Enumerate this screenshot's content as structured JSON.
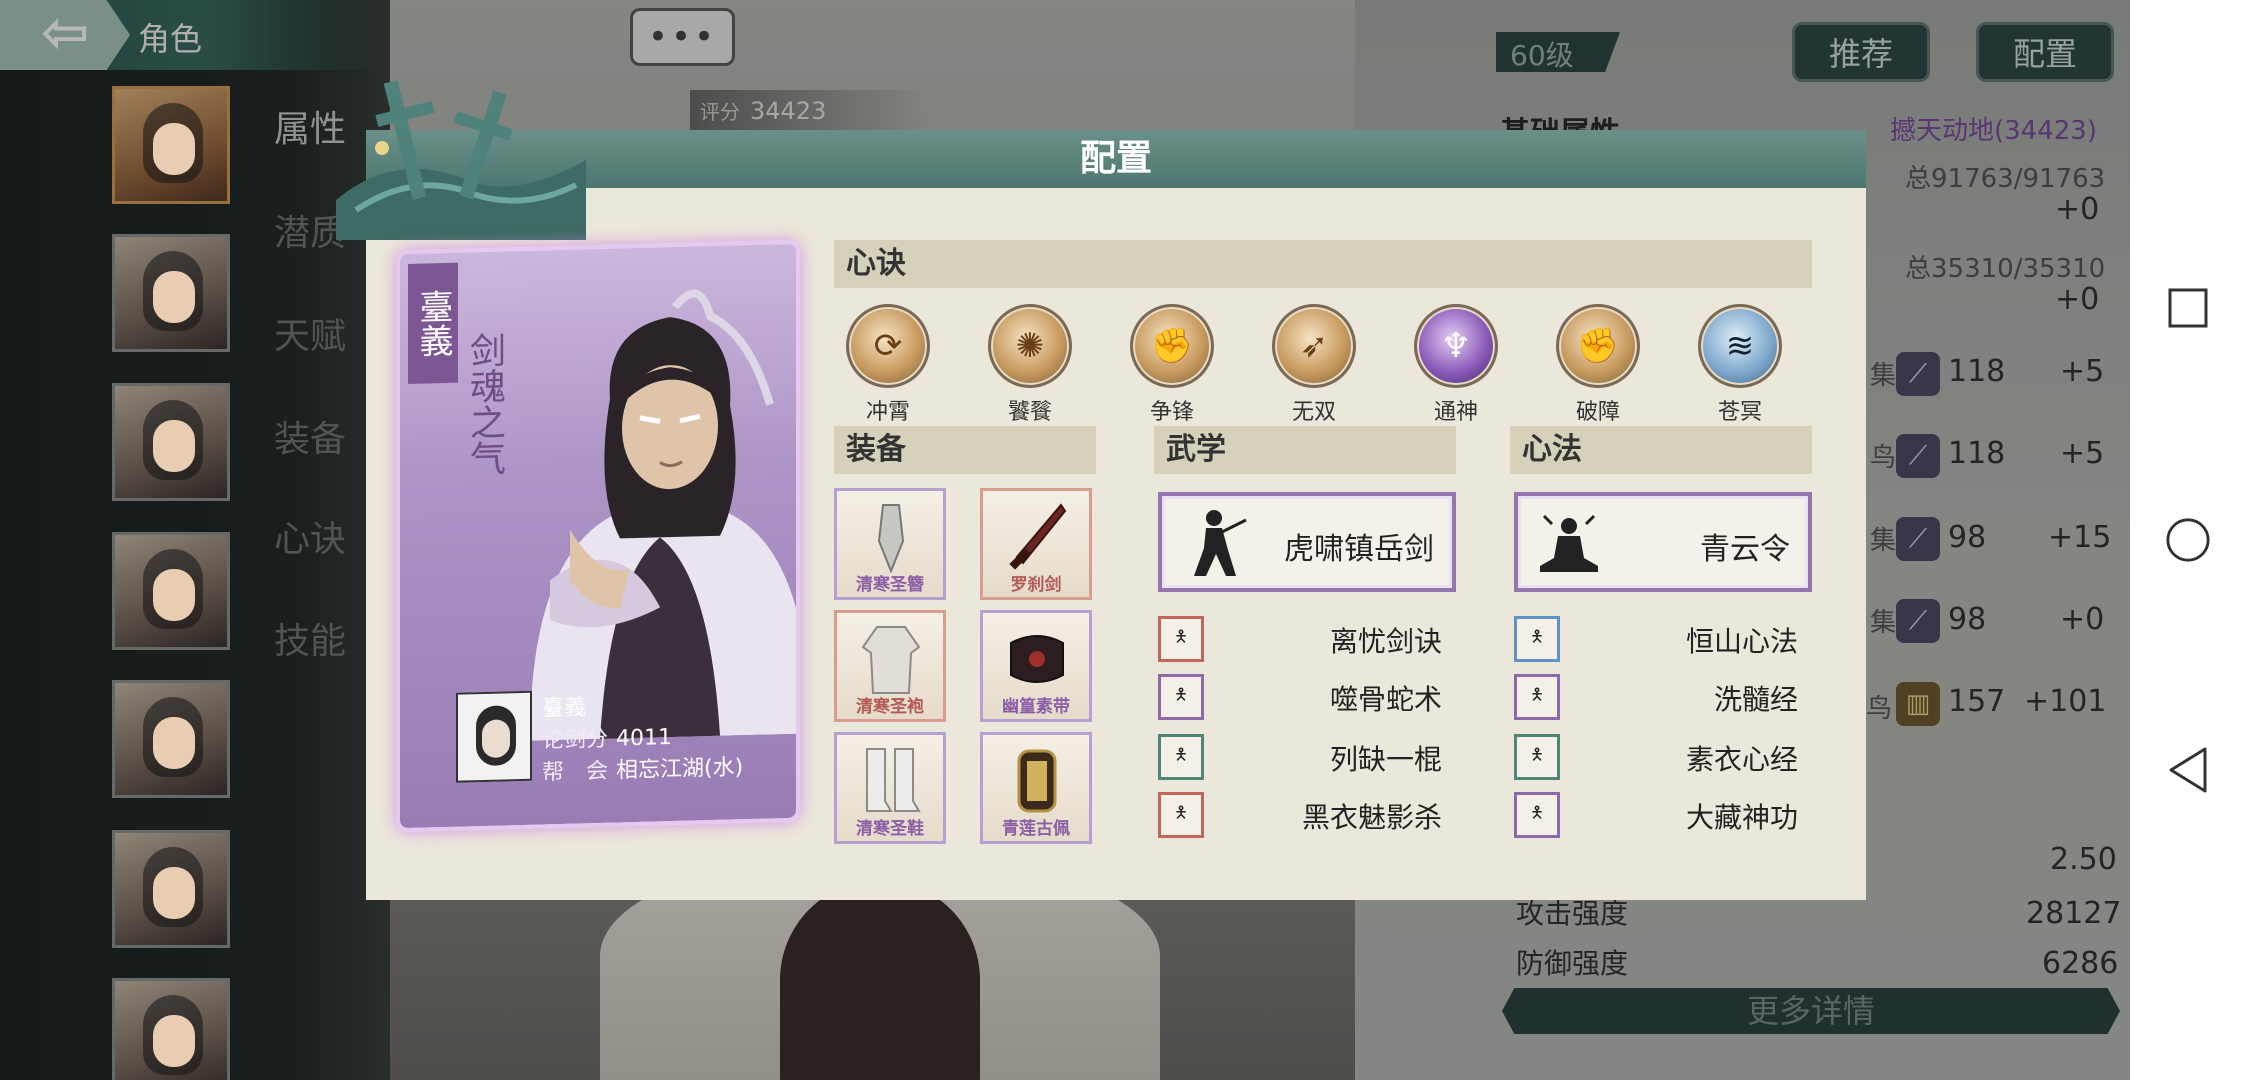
{
  "header": {
    "title": "角色"
  },
  "chat_button": {
    "label": "•••"
  },
  "score_bar": {
    "label": "评分",
    "value": "34423"
  },
  "sidebar": {
    "tabs": [
      {
        "label": "属性"
      },
      {
        "label": "潜质"
      },
      {
        "label": "天赋"
      },
      {
        "label": "装备"
      },
      {
        "label": "心诀"
      },
      {
        "label": "技能"
      }
    ]
  },
  "right_panel": {
    "level": "60级",
    "recommend_label": "推荐",
    "config_label": "配置",
    "base_attr_title": "基础属性",
    "combat_title": "撼天动地(34423)",
    "hp_total": "总91763/91763",
    "hp_bonus": "+0",
    "mp_total": "总35310/35310",
    "mp_bonus": "+0",
    "stats": [
      {
        "label": "集",
        "value": "118",
        "bonus": "+5"
      },
      {
        "label": "鸟",
        "value": "118",
        "bonus": "+5"
      },
      {
        "label": "集",
        "value": "98",
        "bonus": "+15"
      },
      {
        "label": "集",
        "value": "98",
        "bonus": "+0"
      },
      {
        "label": "鸟",
        "value": "157",
        "bonus": "+101"
      }
    ],
    "crit_value": "2.50",
    "attack_label": "攻击强度",
    "attack_value": "28127",
    "defense_label": "防御强度",
    "defense_value": "6286",
    "more_label": "更多详情"
  },
  "modal": {
    "title": "配置",
    "character": {
      "name": "臺義",
      "title": "剑魂之气",
      "info_name": "臺義",
      "score_label": "论剑分",
      "score": "4011",
      "guild_label": "帮　会",
      "guild": "相忘江湖(水)"
    },
    "xinjue": {
      "header": "心诀",
      "skills": [
        {
          "name": "冲霄",
          "icon": "swirl-icon",
          "glyph": "⟳"
        },
        {
          "name": "饕餮",
          "icon": "beast-icon",
          "glyph": "✺"
        },
        {
          "name": "争锋",
          "icon": "fist-icon",
          "glyph": "✊"
        },
        {
          "name": "无双",
          "icon": "dragon-icon",
          "glyph": "➶"
        },
        {
          "name": "通神",
          "icon": "spirit-icon",
          "glyph": "♆"
        },
        {
          "name": "破障",
          "icon": "punch-icon",
          "glyph": "✊"
        },
        {
          "name": "苍冥",
          "icon": "wave-icon",
          "glyph": "≋"
        }
      ]
    },
    "equipment": {
      "header": "装备",
      "items": [
        {
          "name": "清寒圣簪",
          "icon": "hairpin-icon",
          "rarity": "purple"
        },
        {
          "name": "罗刹剑",
          "icon": "sword-icon",
          "rarity": "red"
        },
        {
          "name": "清寒圣袍",
          "icon": "robe-icon",
          "rarity": "red"
        },
        {
          "name": "幽篁素带",
          "icon": "belt-icon",
          "rarity": "purple"
        },
        {
          "name": "清寒圣鞋",
          "icon": "boots-icon",
          "rarity": "purple"
        },
        {
          "name": "青莲古佩",
          "icon": "pendant-icon",
          "rarity": "purple"
        }
      ]
    },
    "martial": {
      "header": "武学",
      "main": "虎啸镇岳剑",
      "subs": [
        {
          "name": "离忧剑诀",
          "color": "red"
        },
        {
          "name": "噬骨蛇术",
          "color": "purple"
        },
        {
          "name": "列缺一棍",
          "color": "teal"
        },
        {
          "name": "黑衣魅影杀",
          "color": "red"
        }
      ]
    },
    "method": {
      "header": "心法",
      "main": "青云令",
      "subs": [
        {
          "name": "恒山心法",
          "color": "blue"
        },
        {
          "name": "洗髓经",
          "color": "purple"
        },
        {
          "name": "素衣心经",
          "color": "teal"
        },
        {
          "name": "大藏神功",
          "color": "purple"
        }
      ]
    }
  }
}
